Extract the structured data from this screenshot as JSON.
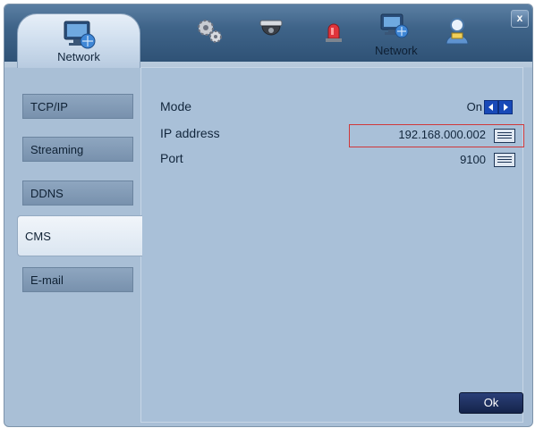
{
  "header": {
    "active_tab_label": "Network",
    "second_network_label": "Network",
    "close_label": "x",
    "icons": [
      "network-icon",
      "gears-icon",
      "camera-dome-icon",
      "alarm-siren-icon",
      "network-icon",
      "user-icon"
    ]
  },
  "sidebar": {
    "items": [
      {
        "label": "TCP/IP"
      },
      {
        "label": "Streaming"
      },
      {
        "label": "DDNS"
      },
      {
        "label": "CMS"
      },
      {
        "label": "E-mail"
      }
    ],
    "active_index": 3
  },
  "settings": {
    "mode": {
      "label": "Mode",
      "value": "On"
    },
    "ip_address": {
      "label": "IP address",
      "value": "192.168.000.002"
    },
    "port": {
      "label": "Port",
      "value": "9100"
    }
  },
  "footer": {
    "ok_label": "Ok"
  },
  "colors": {
    "highlight_border": "#d0383a",
    "arrow_button": "#1849b8",
    "panel_background": "#a9c0d8"
  }
}
